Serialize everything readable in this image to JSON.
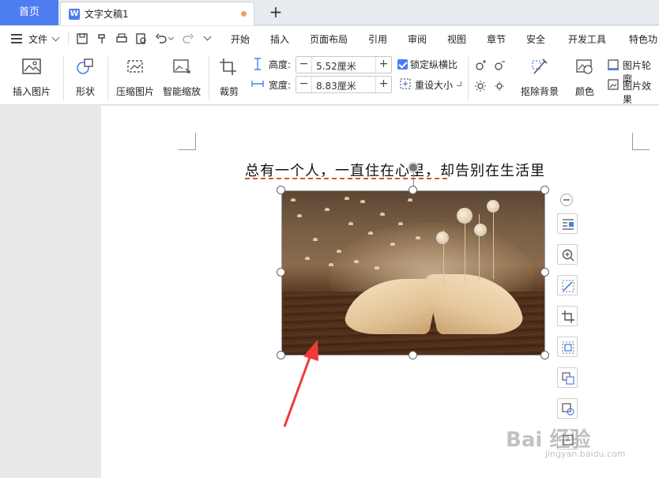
{
  "tabs": {
    "home": "首页",
    "document": "文字文稿1",
    "doc_icon_letter": "W",
    "add": "+"
  },
  "menu": {
    "file": "文件",
    "items": [
      "开始",
      "插入",
      "页面布局",
      "引用",
      "审阅",
      "视图",
      "章节",
      "安全",
      "开发工具",
      "特色功"
    ]
  },
  "ribbon": {
    "insert_picture": "插入图片",
    "shape": "形状",
    "compress_picture": "压缩图片",
    "smart_zoom": "智能缩放",
    "crop": "裁剪",
    "height_label": "高度:",
    "height_value": "5.52厘米",
    "width_label": "宽度:",
    "width_value": "8.83厘米",
    "minus": "−",
    "plus": "+",
    "lock_ratio": "锁定纵横比",
    "lock_ratio_checked": true,
    "reset_size": "重设大小",
    "remove_background": "抠除背景",
    "color": "颜色",
    "picture_outline": "图片轮廓",
    "picture_effect": "图片效果"
  },
  "document": {
    "text": "总有一个人，一直住在心里，却告别在生活里"
  },
  "watermark": {
    "brand": "Bai 经验",
    "url": "jingyan.baidu.com"
  },
  "colors": {
    "accent": "#4d7df0",
    "arrow": "#f03a3a"
  }
}
